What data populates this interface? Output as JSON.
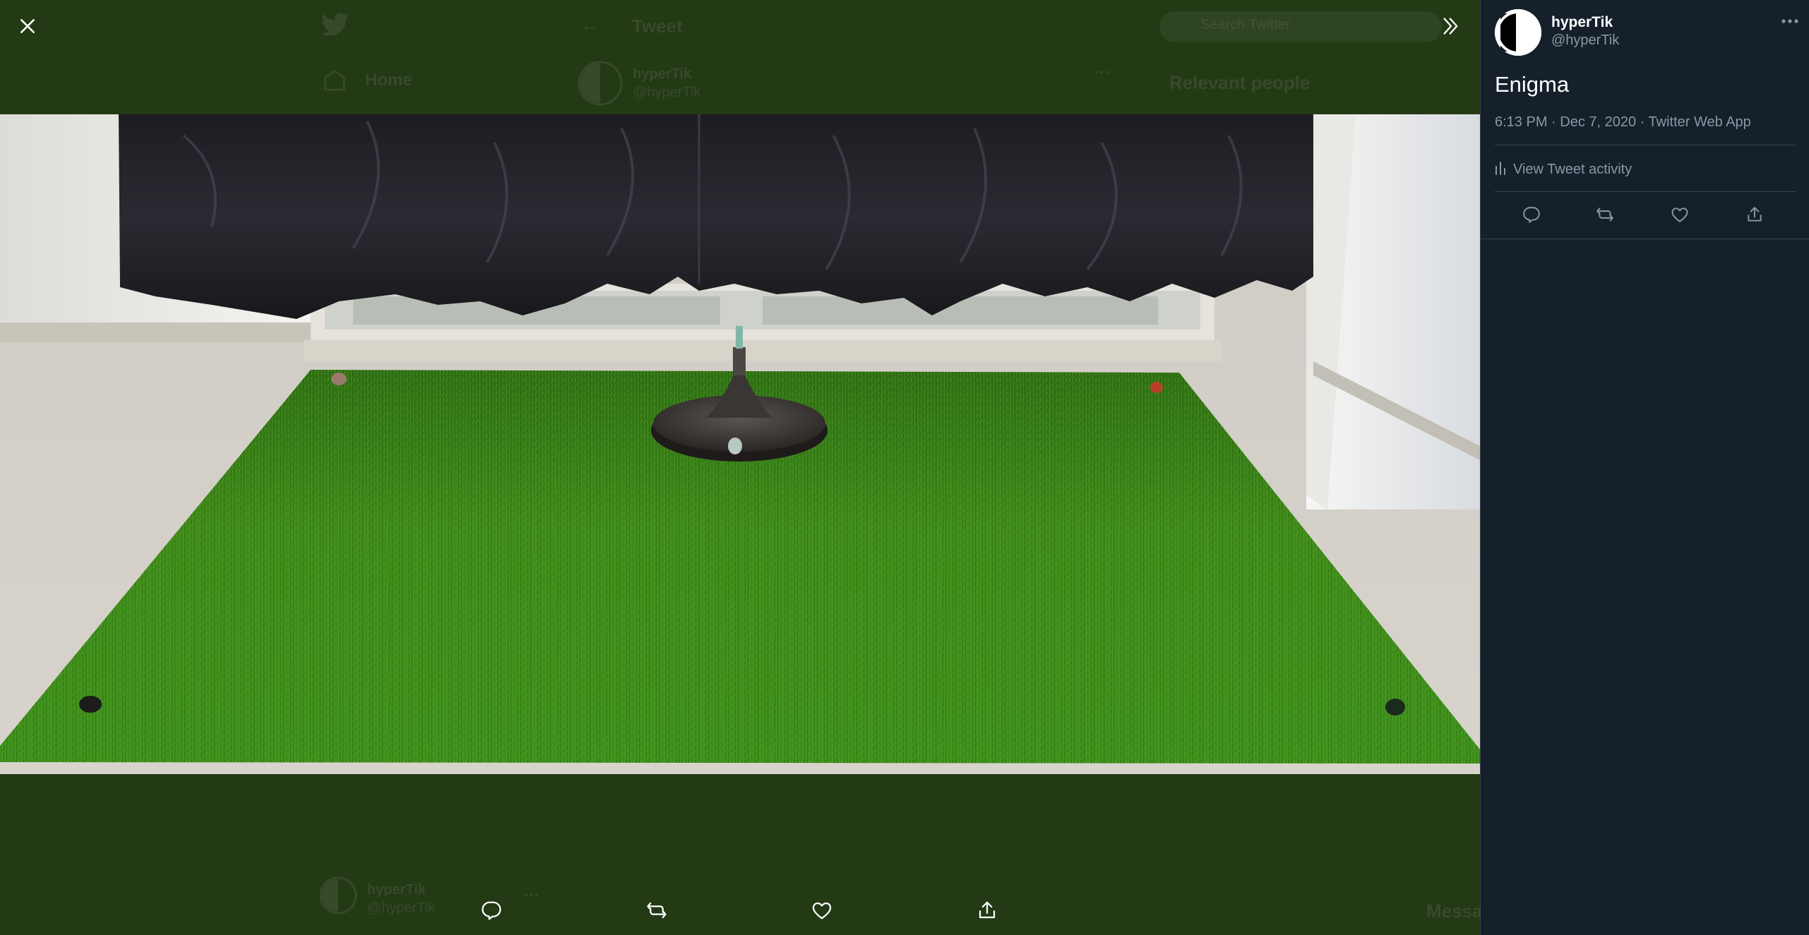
{
  "background_timeline": {
    "nav_home": "Home",
    "header_title": "Tweet",
    "search_placeholder": "Search Twitter",
    "author_name": "hyperTik",
    "author_handle": "@hyperTik",
    "relevant_people": "Relevant people",
    "bottom_author_name": "hyperTik",
    "bottom_author_handle": "@hyperTik",
    "messages_label": "Messa"
  },
  "viewer": {
    "close_icon": "close-icon",
    "expand_icon": "double-chevron-right-icon",
    "photo_alt": "Image",
    "actions": [
      "reply-icon",
      "retweet-icon",
      "like-icon",
      "share-icon"
    ]
  },
  "sidebar": {
    "display_name": "hyperTik",
    "handle": "@hyperTik",
    "tweet_text": "Enigma",
    "meta": "6:13 PM · Dec 7, 2020 · Twitter Web App",
    "activity_label": "View Tweet activity",
    "actions": [
      "reply-icon",
      "retweet-icon",
      "like-icon",
      "share-icon"
    ]
  },
  "colors": {
    "overlay_bg": "#243a15",
    "sidebar_bg": "#15202b",
    "border": "#38444d",
    "secondary_text": "#8899a6",
    "primary_text": "#ffffff"
  }
}
